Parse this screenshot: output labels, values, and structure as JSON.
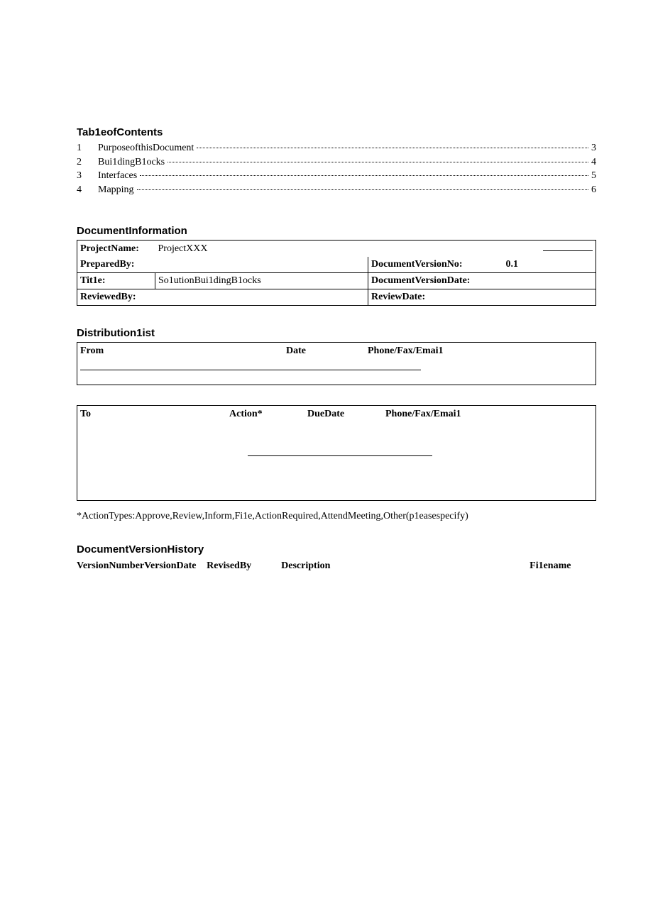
{
  "toc": {
    "heading": "Tab1eofContents",
    "items": [
      {
        "num": "1",
        "title": "PurposeofthisDocument",
        "page": "3"
      },
      {
        "num": "2",
        "title": "Bui1dingB1ocks",
        "page": "4"
      },
      {
        "num": "3",
        "title": "Interfaces",
        "page": "5"
      },
      {
        "num": "4",
        "title": "Mapping",
        "page": "6"
      }
    ]
  },
  "docinfo": {
    "heading": "DocumentInformation",
    "labels": {
      "project_name": "ProjectName:",
      "prepared_by": "PreparedBy:",
      "doc_version_no": "DocumentVersionNo:",
      "title": "Tit1e:",
      "doc_version_date": "DocumentVersionDate:",
      "reviewed_by": "ReviewedBy:",
      "review_date": "ReviewDate:"
    },
    "values": {
      "project_name": "ProjectXXX",
      "doc_version_no": "0.1",
      "title": "So1utionBui1dingB1ocks"
    }
  },
  "distribution": {
    "heading": "Distribution1ist",
    "from_table": {
      "headers": {
        "from": "From",
        "date": "Date",
        "phone": "Phone/Fax/Emai1"
      }
    },
    "to_table": {
      "headers": {
        "to": "To",
        "action": "Action*",
        "due": "DueDate",
        "phone": "Phone/Fax/Emai1"
      }
    },
    "footnote": "*ActionTypes:Approve,Review,Inform,Fi1e,ActionRequired,AttendMeeting,Other(p1easespecify)"
  },
  "version_history": {
    "heading": "DocumentVersionHistory",
    "headers": {
      "version_number": "VersionNumber",
      "version_date": "VersionDate",
      "revised_by": "RevisedBy",
      "description": "Description",
      "filename": "Fi1ename"
    }
  }
}
